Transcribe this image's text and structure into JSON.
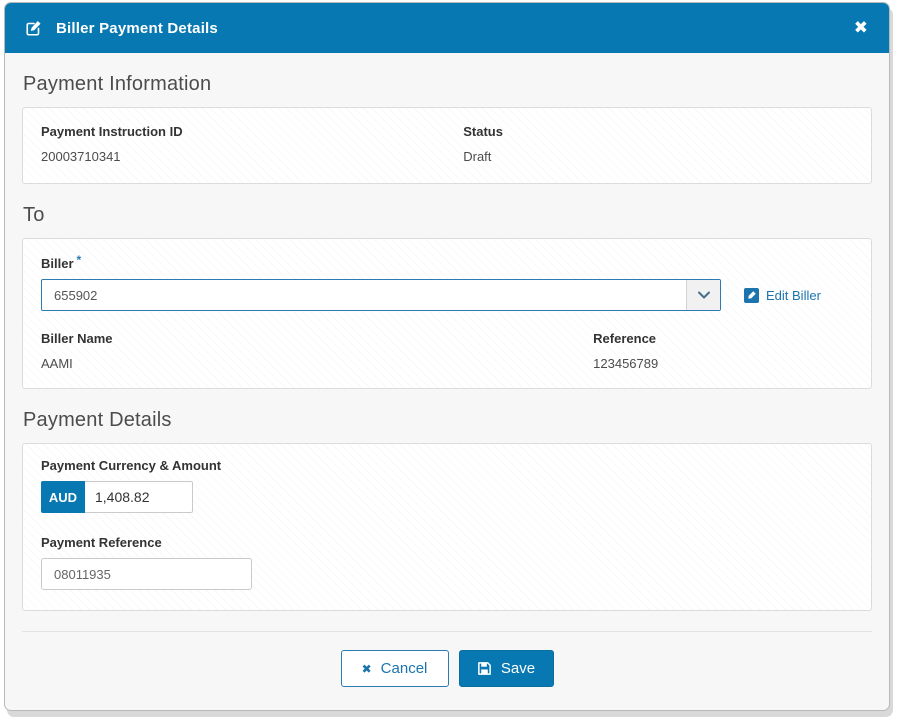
{
  "modal": {
    "title": "Biller Payment Details"
  },
  "icons": {
    "close_glyph": "✖",
    "cancel_glyph": "✖",
    "required_marker": "*"
  },
  "payment_information": {
    "heading": "Payment Information",
    "instruction_id_label": "Payment Instruction ID",
    "instruction_id_value": "20003710341",
    "status_label": "Status",
    "status_value": "Draft"
  },
  "to": {
    "heading": "To",
    "biller_label": "Biller",
    "biller_value": "655902",
    "edit_biller_label": "Edit Biller",
    "biller_name_label": "Biller Name",
    "biller_name_value": "AAMI",
    "reference_label": "Reference",
    "reference_value": "123456789"
  },
  "payment_details": {
    "heading": "Payment Details",
    "currency_amount_label": "Payment Currency & Amount",
    "currency_code": "AUD",
    "amount_value": "1,408.82",
    "payment_reference_label": "Payment Reference",
    "payment_reference_value": "08011935"
  },
  "footer": {
    "cancel_label": "Cancel",
    "save_label": "Save"
  },
  "colors": {
    "primary_blue": "#0778b2",
    "link_blue": "#1b74ae"
  }
}
